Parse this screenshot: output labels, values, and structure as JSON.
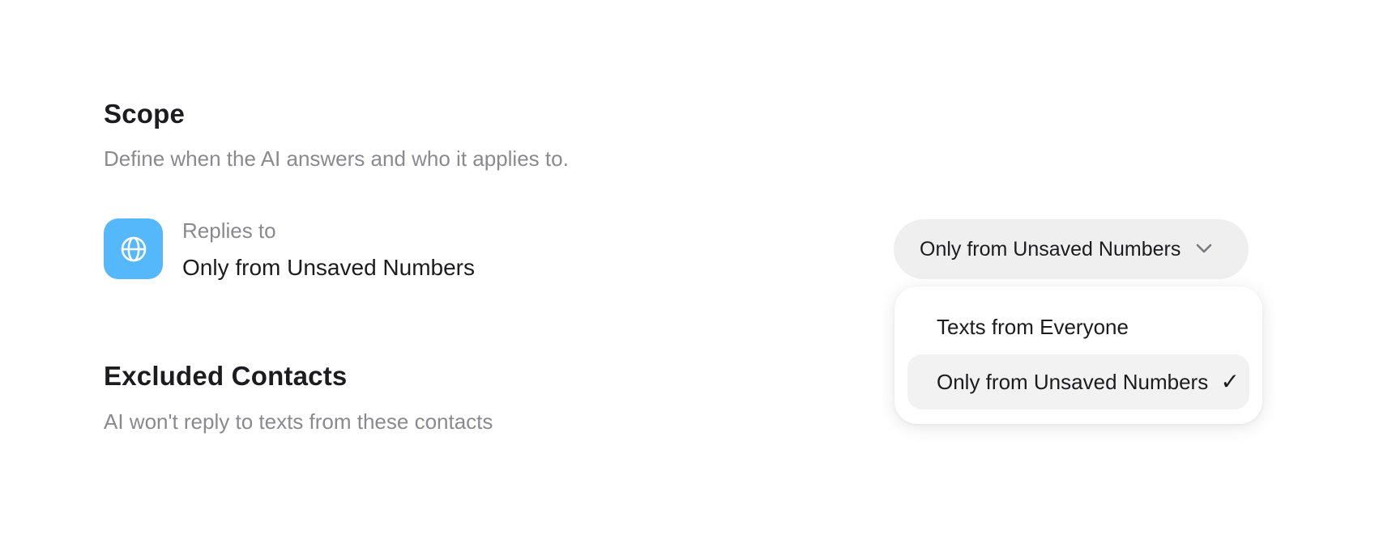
{
  "scope": {
    "title": "Scope",
    "subtitle": "Define when the AI answers and who it applies to."
  },
  "replies": {
    "icon": "globe-icon",
    "icon_color": "#54b8fa",
    "label": "Replies to",
    "value": "Only from Unsaved Numbers"
  },
  "select": {
    "selected_label": "Only from Unsaved Numbers",
    "options": [
      {
        "label": "Texts from Everyone",
        "selected": false
      },
      {
        "label": "Only from Unsaved Numbers",
        "selected": true
      }
    ],
    "check_glyph": "✓"
  },
  "excluded": {
    "title": "Excluded Contacts",
    "subtitle": "AI won't reply to texts from these contacts"
  }
}
